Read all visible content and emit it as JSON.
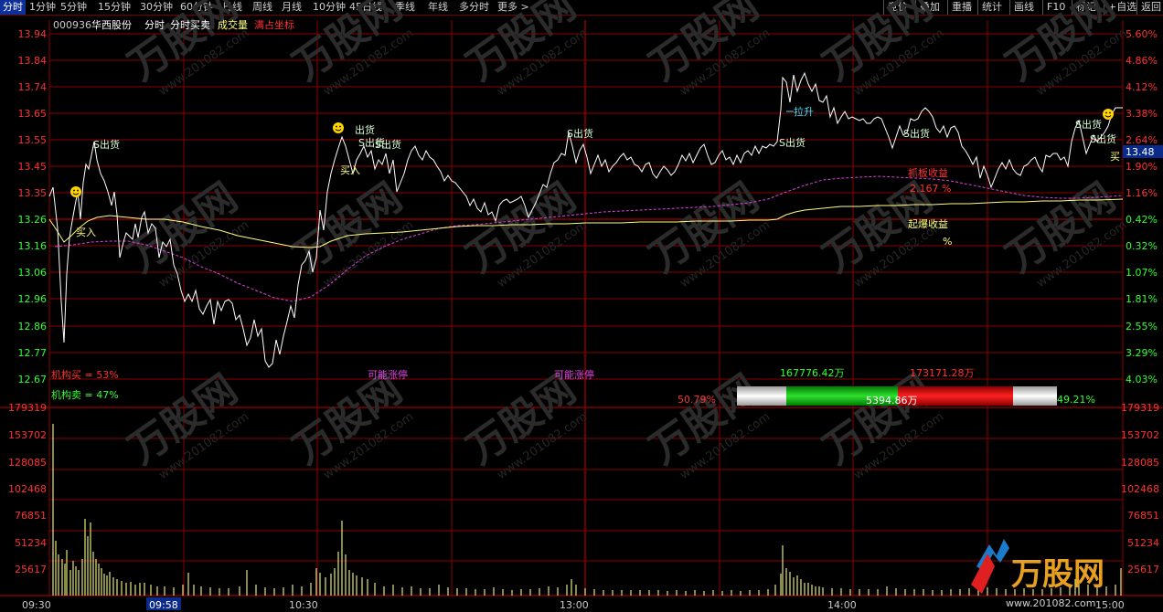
{
  "toolbar": {
    "tabs": [
      {
        "label": "分时",
        "active": true
      },
      {
        "label": "1分钟"
      },
      {
        "label": "5分钟"
      },
      {
        "label": "15分钟"
      },
      {
        "label": "30分钟"
      },
      {
        "label": "60分钟"
      },
      {
        "label": "日线"
      },
      {
        "label": "周线"
      },
      {
        "label": "月线"
      },
      {
        "label": "10分钟"
      },
      {
        "label": "45日线"
      },
      {
        "label": "季线"
      },
      {
        "label": "年线"
      },
      {
        "label": "多分时"
      },
      {
        "label": "更多 >"
      }
    ],
    "right_tabs": [
      "竞价",
      "叠加",
      "重播",
      "统计",
      "画线",
      "F10",
      "标记",
      "+自选",
      "返回"
    ]
  },
  "header": {
    "stock_code": "000936",
    "stock_name": "华西股份",
    "mode_label": "分时",
    "sub_label": "分时买卖",
    "volume_label": "成交量",
    "coord_label": "满占坐标"
  },
  "colors": {
    "grid": "#8b0000",
    "price_line": "#ffffff",
    "avg_line": "#ffff7f",
    "ma_line": "#e040e0",
    "volume_bar": "#d6d670",
    "buy_text": "#ffff7f",
    "sell_text": "#d6ffd6",
    "red": "#ff3030",
    "green": "#30ff30"
  },
  "axes": {
    "price_labels": [
      "13.94",
      "13.84",
      "13.74",
      "13.65",
      "13.55",
      "13.45",
      "13.35",
      "13.26",
      "13.16",
      "13.06",
      "12.96",
      "12.86",
      "12.77",
      "12.67"
    ],
    "pct_labels": [
      "5.60%",
      "4.86%",
      "4.12%",
      "3.38%",
      "2.64%",
      "1.90%",
      "1.16%",
      "0.42%",
      "0.32%",
      "1.07%",
      "1.81%",
      "2.55%",
      "3.29%",
      "4.03%"
    ],
    "volume_labels": [
      "179319",
      "153702",
      "128085",
      "102468",
      "76851",
      "51234",
      "25617"
    ],
    "time_labels": [
      "09:30",
      "09:58",
      "10:30",
      "13:00",
      "14:00",
      "15:00"
    ],
    "current_price": "13.48"
  },
  "signals": {
    "sell": "S出货",
    "sell_alt": "出货",
    "buy": "买入",
    "buy_short": "买",
    "lift": "拉升",
    "limit_up": "可能涨停"
  },
  "stats": {
    "inst_buy": "机构买 = 53%",
    "inst_sell": "机构卖 = 47%",
    "grab_label": "抓板收益",
    "grab_value": "2.167 %",
    "burst_label": "起爆收益",
    "burst_value": "%"
  },
  "flow": {
    "buy_amount": "167776.42万",
    "sell_amount": "173171.28万",
    "net_amount": "5394.86万",
    "buy_pct": "50.79%",
    "sell_pct": "49.21%"
  },
  "watermark": {
    "brand": "万股网",
    "url": "www.201082.com"
  }
}
